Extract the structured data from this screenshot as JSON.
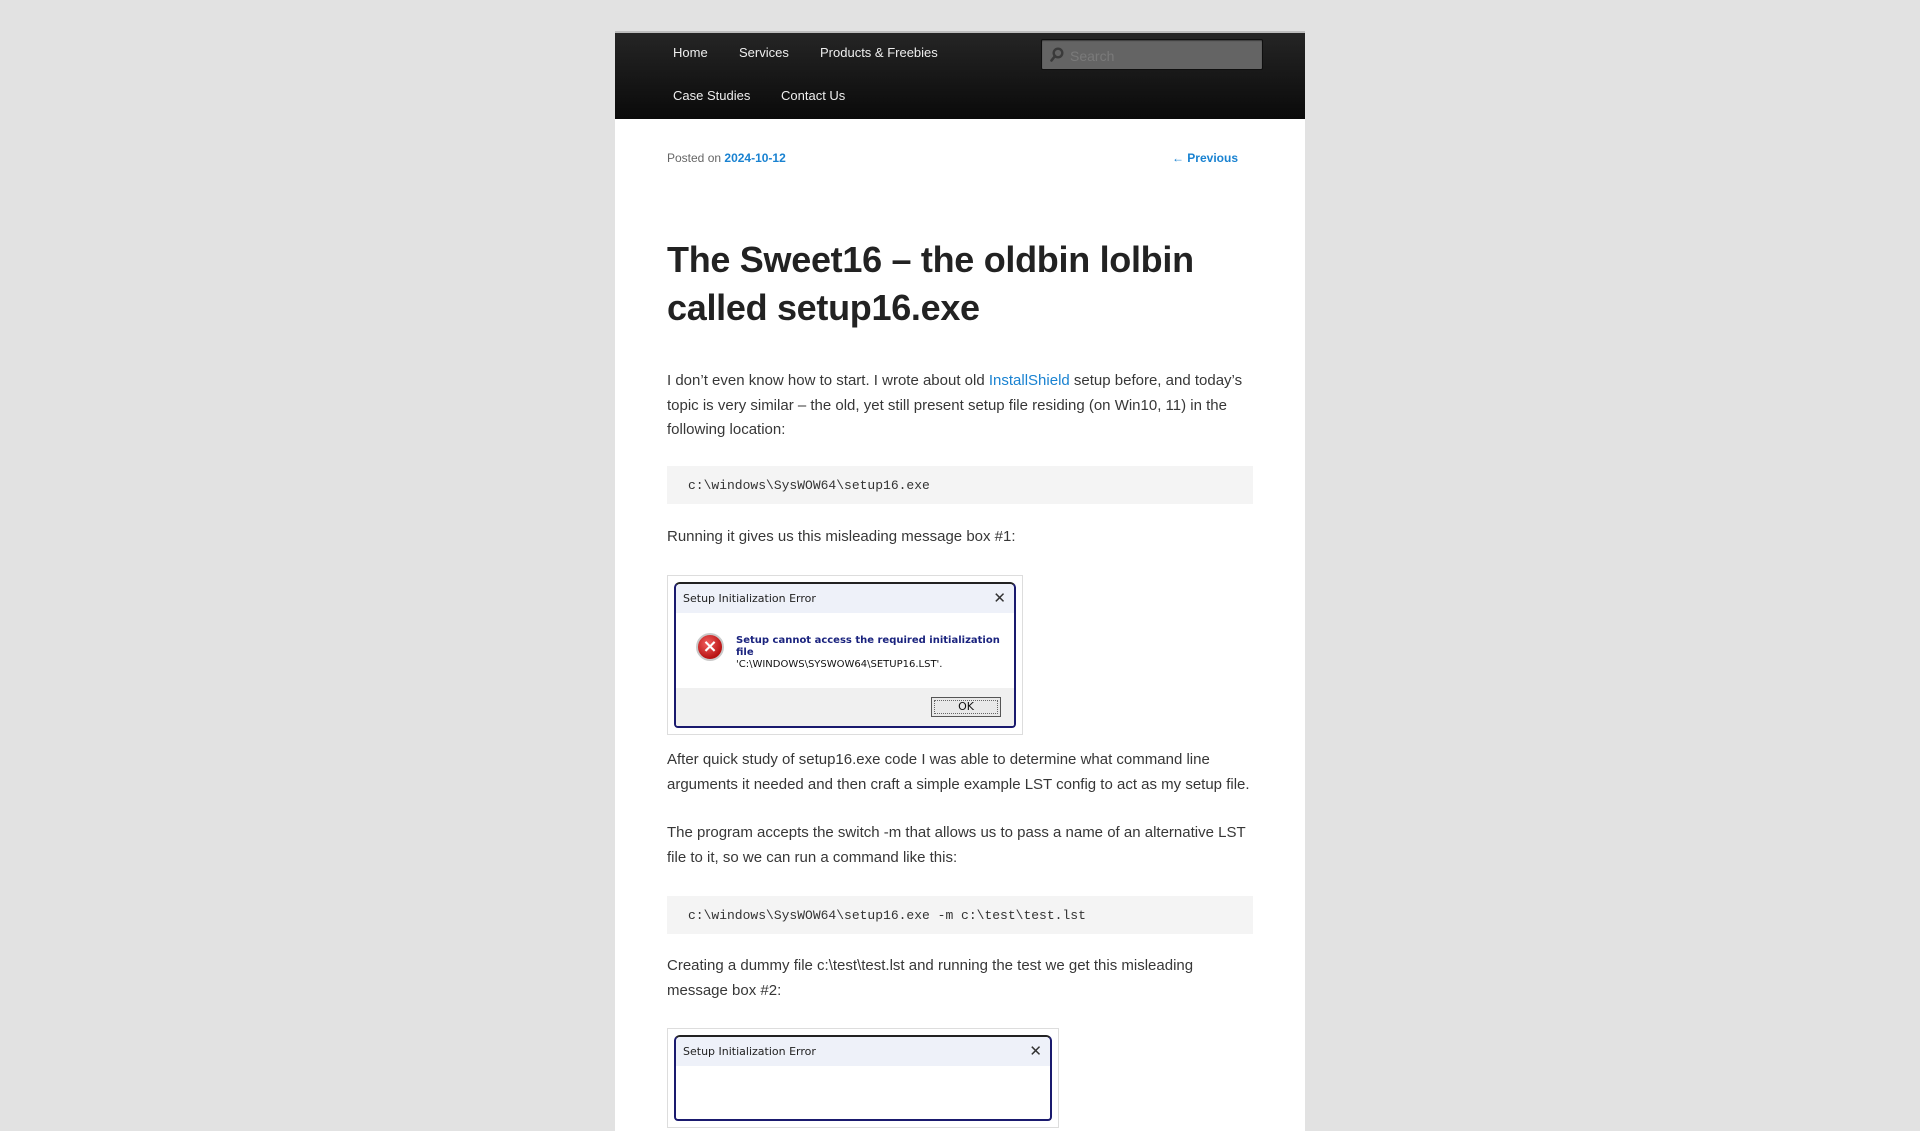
{
  "nav": {
    "items": [
      {
        "label": "Home"
      },
      {
        "label": "Services"
      },
      {
        "label": "Products & Freebies"
      },
      {
        "label": "Case Studies"
      },
      {
        "label": "Contact Us"
      }
    ],
    "search": {
      "placeholder": "Search",
      "value": "",
      "icon": "search-icon"
    }
  },
  "meta": {
    "posted_on_label": "Posted on",
    "date": "2024-10-12",
    "previous_link": "← Previous"
  },
  "post": {
    "title": "The Sweet16 – the oldbin lolbin called setup16.exe",
    "paragraph1_before_link": "I don’t even know how to start. I wrote about old ",
    "paragraph1_link": "InstallShield",
    "paragraph1_after_link": " setup before, and today’s topic is very similar – the old, yet still present setup file residing (on Win10, 11) in the following location:",
    "code1": "c:\\windows\\SysWOW64\\setup16.exe",
    "paragraph2": "Running it gives us this misleading message box #1:",
    "dialog1": {
      "title": "Setup Initialization Error",
      "close": "✕",
      "message_line1": "Setup cannot access the required initialization file",
      "message_line2": "'C:\\WINDOWS\\SYSWOW64\\SETUP16.LST'.",
      "ok_label": "OK",
      "icon": "error-icon"
    },
    "paragraph3": "After quick study of setup16.exe code I was able to determine what command line arguments it needed and then craft a simple example LST config to act as my setup file.",
    "paragraph4": "The program accepts the switch -m that allows us to pass a name of an alternative LST file to it, so we can run a command like this:",
    "code2": "c:\\windows\\SysWOW64\\setup16.exe -m c:\\test\\test.lst",
    "paragraph5": "Creating a dummy file c:\\test\\test.lst and running the test we get this misleading message box #2:",
    "dialog2": {
      "title": "Setup Initialization Error",
      "close": "✕"
    }
  },
  "colors": {
    "link": "#1982d1",
    "background": "#e2e2e2",
    "nav_bg": "#1a1a1a"
  }
}
